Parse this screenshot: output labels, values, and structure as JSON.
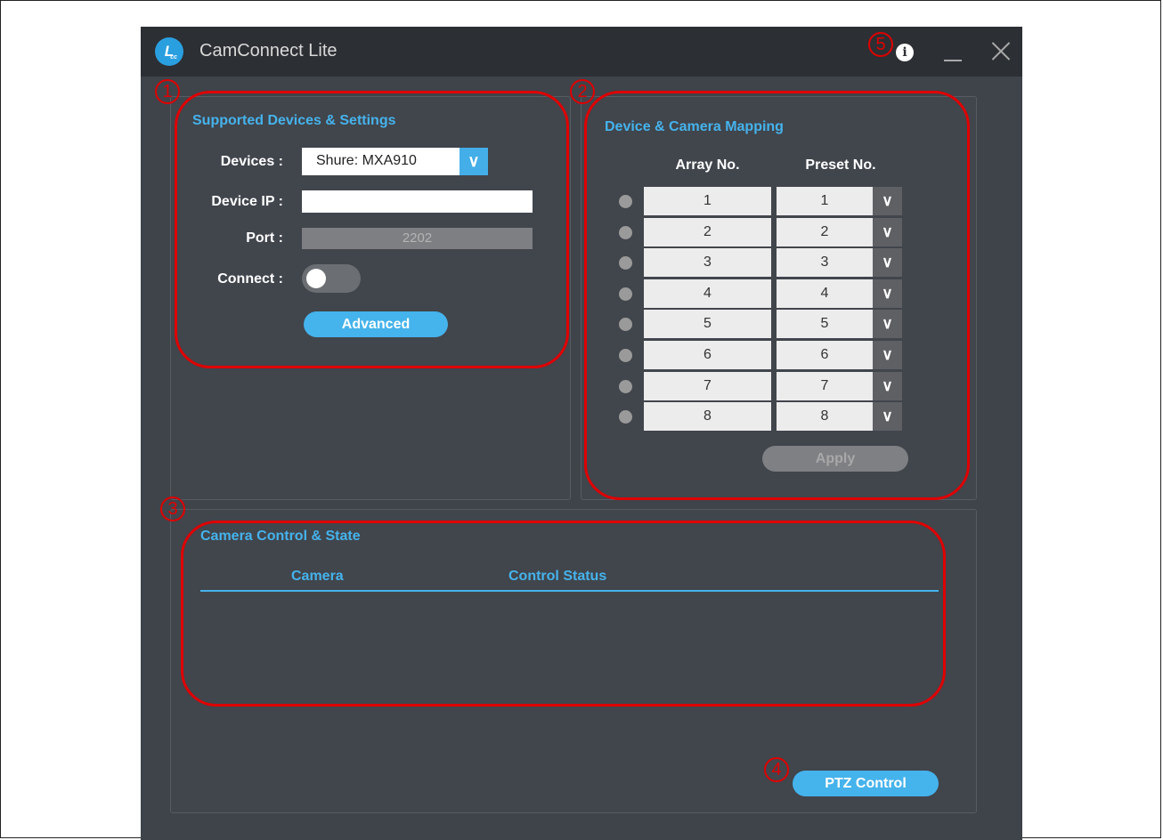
{
  "window": {
    "title": "CamConnect Lite",
    "logo_text": "L",
    "logo_sup": "cc"
  },
  "titlebar": {
    "info_icon": "info-icon",
    "minimize_icon": "minimize-icon",
    "close_icon": "close-icon"
  },
  "devices_panel": {
    "title": "Supported Devices & Settings",
    "devices_label": "Devices :",
    "devices_value": "Shure: MXA910",
    "device_ip_label": "Device IP :",
    "device_ip_value": "",
    "port_label": "Port :",
    "port_value": "2202",
    "connect_label": "Connect :",
    "connect_state": "off",
    "advanced_button": "Advanced"
  },
  "mapping_panel": {
    "title": "Device & Camera Mapping",
    "array_header": "Array No.",
    "preset_header": "Preset No.",
    "rows": [
      {
        "array": "1",
        "preset": "1"
      },
      {
        "array": "2",
        "preset": "2"
      },
      {
        "array": "3",
        "preset": "3"
      },
      {
        "array": "4",
        "preset": "4"
      },
      {
        "array": "5",
        "preset": "5"
      },
      {
        "array": "6",
        "preset": "6"
      },
      {
        "array": "7",
        "preset": "7"
      },
      {
        "array": "8",
        "preset": "8"
      }
    ],
    "apply_button": "Apply"
  },
  "camera_panel": {
    "title": "Camera Control & State",
    "columns": [
      "Camera",
      "Control Status"
    ],
    "ptz_button": "PTZ Control"
  },
  "annotations": [
    "1",
    "2",
    "3",
    "4",
    "5"
  ],
  "colors": {
    "accent": "#45b3ec",
    "annotation": "#e00000",
    "background": "#3f434a",
    "titlebar": "#2c2f33"
  }
}
